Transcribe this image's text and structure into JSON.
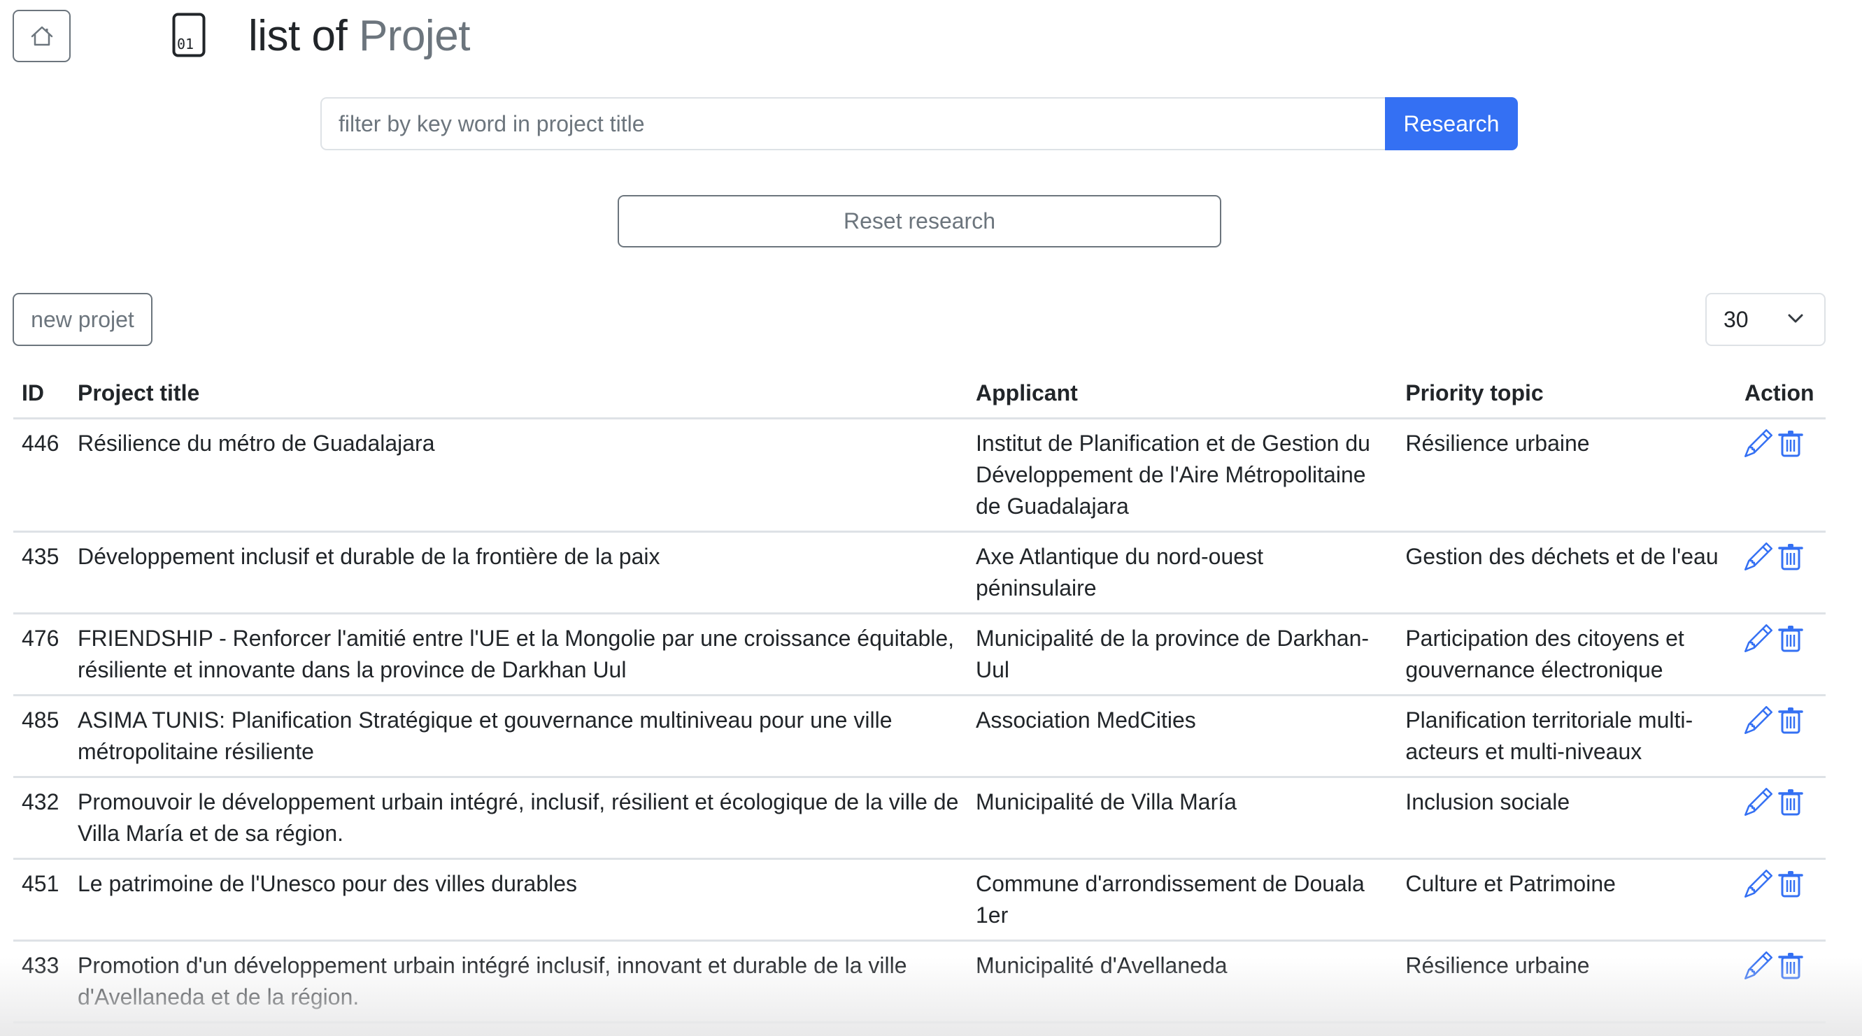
{
  "header": {
    "home_icon": "house-icon",
    "file_icon": "binary-file-icon",
    "file_icon_text": "01",
    "title_prefix": "list of",
    "title_entity": "Projet"
  },
  "search": {
    "placeholder": "filter by key word in project title",
    "value": "",
    "submit_label": "Research",
    "reset_label": "Reset research"
  },
  "toolbar": {
    "new_label": "new projet",
    "page_size": "30",
    "page_size_icon": "chevron-down-icon"
  },
  "colors": {
    "primary": "#3470f3",
    "secondary": "#6c757d",
    "text": "#212529",
    "border": "#dee2e6"
  },
  "table": {
    "columns": [
      "ID",
      "Project title",
      "Applicant",
      "Priority topic",
      "Action"
    ],
    "action_icons": [
      "pencil-icon",
      "trash-icon"
    ],
    "rows": [
      {
        "id": "446",
        "title": "Résilience du métro de Guadalajara",
        "applicant": "Institut de Planification et de Gestion du Développement de l'Aire Métropolitaine de Guadalajara",
        "topic": "Résilience urbaine"
      },
      {
        "id": "435",
        "title": "Développement inclusif et durable de la frontière de la paix",
        "applicant": "Axe Atlantique du nord-ouest péninsulaire",
        "topic": "Gestion des déchets et de l'eau"
      },
      {
        "id": "476",
        "title": "FRIENDSHIP - Renforcer l'amitié entre l'UE et la Mongolie par une croissance équitable, résiliente et innovante dans la province de Darkhan Uul",
        "applicant": "Municipalité de la province de Darkhan-Uul",
        "topic": "Participation des citoyens et gouvernance électronique"
      },
      {
        "id": "485",
        "title": "ASIMA TUNIS: Planification Stratégique et gouvernance multiniveau pour une ville métropolitaine résiliente",
        "applicant": "Association MedCities",
        "topic": "Planification territoriale multi-acteurs et multi-niveaux"
      },
      {
        "id": "432",
        "title": "Promouvoir le développement urbain intégré, inclusif, résilient et écologique de la ville de Villa María et de sa région.",
        "applicant": "Municipalité de Villa María",
        "topic": "Inclusion sociale"
      },
      {
        "id": "451",
        "title": "Le patrimoine de l'Unesco pour des villes durables",
        "applicant": "Commune d'arrondissement de Douala 1er",
        "topic": "Culture et Patrimoine"
      },
      {
        "id": "433",
        "title": "Promotion d'un développement urbain intégré inclusif, innovant et durable de la ville d'Avellaneda et de la région.",
        "applicant": "Municipalité d'Avellaneda",
        "topic": "Résilience urbaine"
      }
    ]
  }
}
